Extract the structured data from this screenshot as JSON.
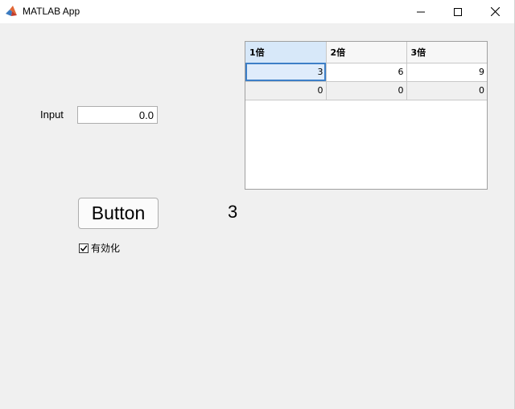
{
  "window": {
    "title": "MATLAB App",
    "icon": "matlab-logo-icon",
    "controls": [
      "minimize-icon",
      "maximize-icon",
      "close-icon"
    ]
  },
  "input": {
    "label": "Input",
    "value": "0.0"
  },
  "button": {
    "label": "Button"
  },
  "value_label": {
    "text": "3"
  },
  "checkbox": {
    "label": "有効化",
    "checked": true
  },
  "table": {
    "columns": [
      "1倍",
      "2倍",
      "3倍"
    ],
    "rows": [
      [
        "3",
        "6",
        "9"
      ],
      [
        "0",
        "0",
        "0"
      ]
    ],
    "selected_cell": [
      0,
      0
    ]
  },
  "colors": {
    "titlebar": "#ffffff",
    "background": "#f0f0f0",
    "selection_border": "#3d7fc7",
    "header_active": "#d7e8f9"
  }
}
